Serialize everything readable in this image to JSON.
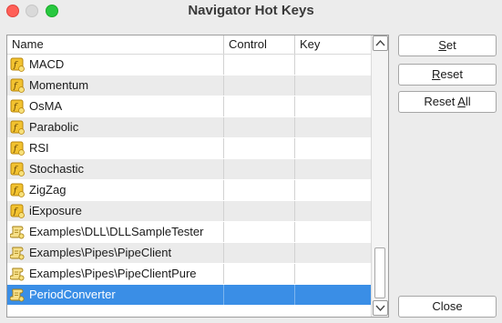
{
  "window": {
    "title": "Navigator Hot Keys"
  },
  "table": {
    "columns": [
      "Name",
      "Control",
      "Key"
    ],
    "rows": [
      {
        "name": "MACD",
        "control": "",
        "key": "",
        "icon": "indicator-icon"
      },
      {
        "name": "Momentum",
        "control": "",
        "key": "",
        "icon": "indicator-icon"
      },
      {
        "name": "OsMA",
        "control": "",
        "key": "",
        "icon": "indicator-icon"
      },
      {
        "name": "Parabolic",
        "control": "",
        "key": "",
        "icon": "indicator-icon"
      },
      {
        "name": "RSI",
        "control": "",
        "key": "",
        "icon": "indicator-icon"
      },
      {
        "name": "Stochastic",
        "control": "",
        "key": "",
        "icon": "indicator-icon"
      },
      {
        "name": "ZigZag",
        "control": "",
        "key": "",
        "icon": "indicator-icon"
      },
      {
        "name": "iExposure",
        "control": "",
        "key": "",
        "icon": "indicator-icon"
      },
      {
        "name": "Examples\\DLL\\DLLSampleTester",
        "control": "",
        "key": "",
        "icon": "script-icon"
      },
      {
        "name": "Examples\\Pipes\\PipeClient",
        "control": "",
        "key": "",
        "icon": "script-icon"
      },
      {
        "name": "Examples\\Pipes\\PipeClientPure",
        "control": "",
        "key": "",
        "icon": "script-icon"
      },
      {
        "name": "PeriodConverter",
        "control": "",
        "key": "",
        "icon": "script-icon",
        "selected": true
      }
    ]
  },
  "buttons": {
    "set": {
      "first": "S",
      "rest": "et"
    },
    "reset": {
      "first": "R",
      "rest": "eset"
    },
    "reset_all": {
      "pre": "Reset ",
      "ul": "A",
      "rest": "ll"
    },
    "close": "Close"
  },
  "colors": {
    "selection": "#3a8ee6",
    "alt_row": "#ebebeb",
    "close_light": "#ff5f57",
    "max_light": "#28c840"
  }
}
